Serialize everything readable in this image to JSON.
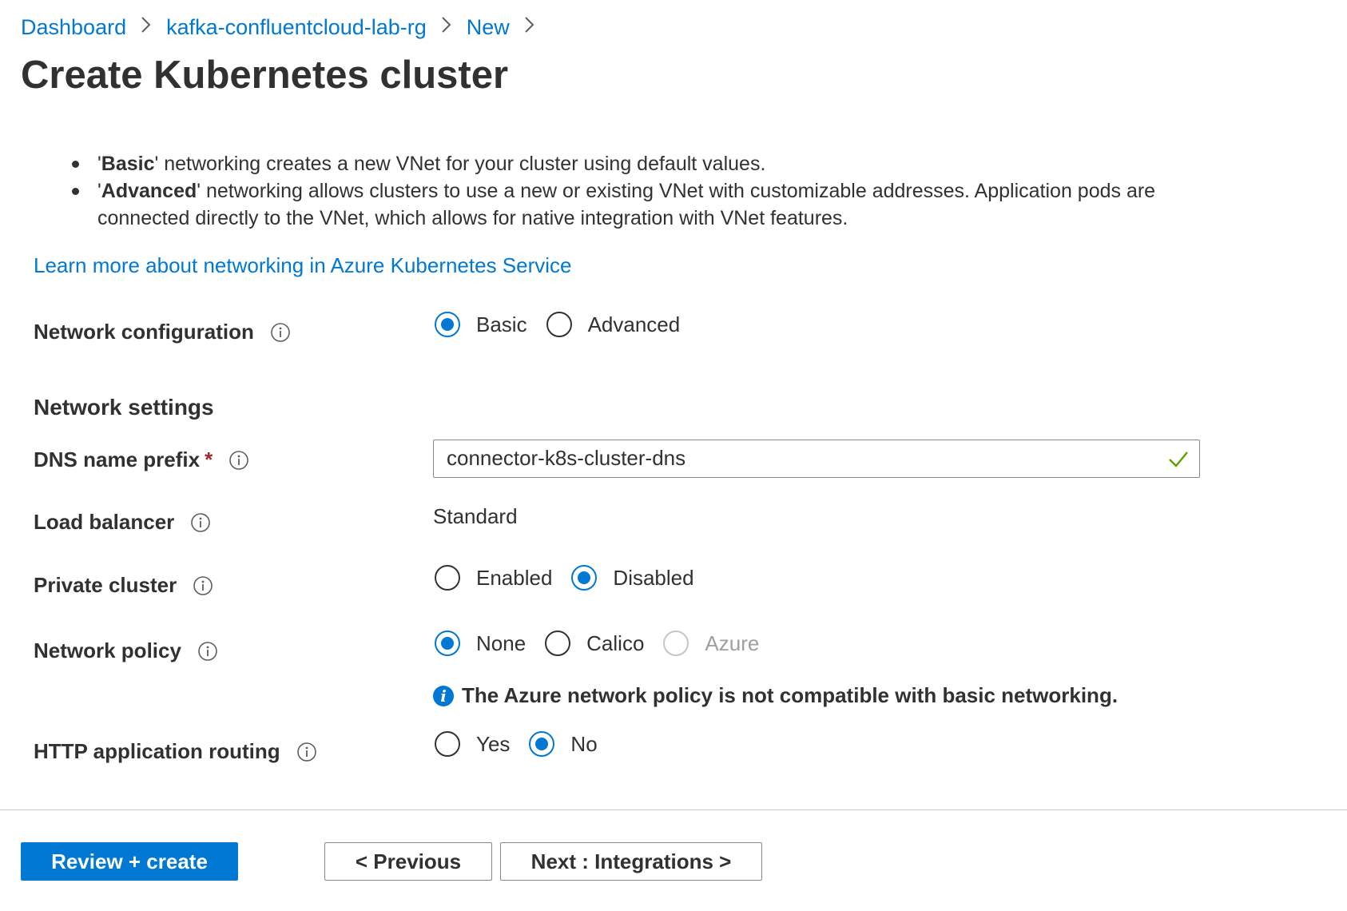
{
  "breadcrumb": {
    "items": [
      "Dashboard",
      "kafka-confluentcloud-lab-rg",
      "New"
    ],
    "separator": ">"
  },
  "page_title": "Create Kubernetes cluster",
  "intro": {
    "bullet1_bold": "Basic",
    "bullet1_rest": " networking creates a new VNet for your cluster using default values.",
    "bullet2_bold": "Advanced",
    "bullet2_rest": " networking allows clusters to use a new or existing VNet with customizable addresses. Application pods are connected directly to the VNet, which allows for native integration with VNet features.",
    "quote": "'"
  },
  "learn_more_link": "Learn more about networking in Azure Kubernetes Service",
  "network_configuration": {
    "label": "Network configuration",
    "options": [
      {
        "label": "Basic",
        "selected": true
      },
      {
        "label": "Advanced",
        "selected": false
      }
    ]
  },
  "network_settings_heading": "Network settings",
  "dns_name_prefix": {
    "label": "DNS name prefix",
    "required_marker": "*",
    "value": "connector-k8s-cluster-dns",
    "valid": true
  },
  "load_balancer": {
    "label": "Load balancer",
    "value": "Standard"
  },
  "private_cluster": {
    "label": "Private cluster",
    "options": [
      {
        "label": "Enabled",
        "selected": false
      },
      {
        "label": "Disabled",
        "selected": true
      }
    ]
  },
  "network_policy": {
    "label": "Network policy",
    "options": [
      {
        "label": "None",
        "selected": true
      },
      {
        "label": "Calico",
        "selected": false
      },
      {
        "label": "Azure",
        "selected": false,
        "disabled": true
      }
    ],
    "notice": "The Azure network policy is not compatible with basic networking."
  },
  "http_routing": {
    "label": "HTTP application routing",
    "options": [
      {
        "label": "Yes",
        "selected": false
      },
      {
        "label": "No",
        "selected": true
      }
    ]
  },
  "footer": {
    "review_create": "Review + create",
    "previous": "< Previous",
    "next": "Next : Integrations >"
  },
  "colors": {
    "accent": "#0078d4",
    "text": "#323130",
    "required": "#a4262c",
    "valid_check": "#57a300",
    "disabled": "#c8c6c4"
  },
  "icons": {
    "info": "info-circle-icon",
    "chevron": "chevron-right-icon",
    "checkmark": "checkmark-icon",
    "notice": "info-filled-icon"
  }
}
